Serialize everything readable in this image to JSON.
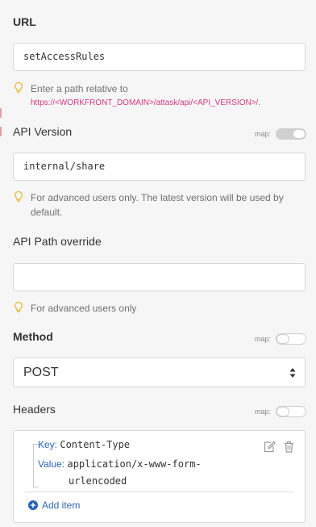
{
  "url": {
    "label": "URL",
    "value": "setAccessRules",
    "hint_text": "Enter a path relative to",
    "hint_link": "https://<WORKFRONT_DOMAIN>/attask/api/<API_VERSION>/."
  },
  "api_version": {
    "label": "API Version",
    "map_label": "map:",
    "map_enabled": true,
    "value": "internal/share",
    "hint_text": "For advanced users only. The latest version will be used by default."
  },
  "api_path_override": {
    "label": "API Path override",
    "value": "",
    "hint_text": "For advanced users only"
  },
  "method": {
    "label": "Method",
    "map_label": "map:",
    "map_enabled": false,
    "selected": "POST"
  },
  "headers": {
    "label": "Headers",
    "map_label": "map:",
    "map_enabled": false,
    "items": [
      {
        "key_label": "Key:",
        "key": "Content-Type",
        "value_label": "Value:",
        "value_line1": "application/x-www-form-",
        "value_line2": "urlencoded"
      }
    ],
    "add_item_label": "Add item"
  },
  "colors": {
    "accent": "#2a64b5",
    "link": "#d1377f",
    "bulb": "#e8b93a"
  }
}
